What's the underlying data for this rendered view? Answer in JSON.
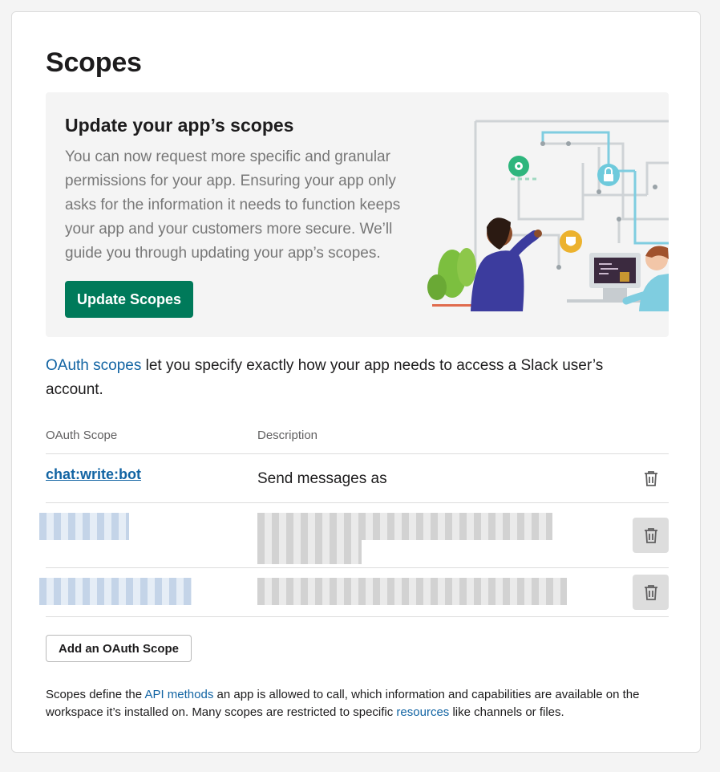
{
  "page": {
    "title": "Scopes"
  },
  "banner": {
    "heading": "Update your app’s scopes",
    "body": "You can now request more specific and granular permissions for your app. Ensuring your app only asks for the information it needs to function keeps your app and your customers more secure. We’ll guide you through updating your app’s scopes.",
    "button_label": "Update Scopes",
    "illustration": "person-drawing-connections-illustration"
  },
  "intro": {
    "link_text": "OAuth scopes",
    "rest": " let you specify exactly how your app needs to access a Slack user’s account."
  },
  "table": {
    "headers": {
      "scope": "OAuth Scope",
      "description": "Description"
    },
    "rows": [
      {
        "scope": "chat:write:bot",
        "description": "Send messages as",
        "delete_icon": "trash-icon"
      },
      {
        "scope": "",
        "description": "",
        "redacted": true,
        "delete_icon": "trash-icon"
      },
      {
        "scope": "",
        "description": "",
        "redacted": true,
        "delete_icon": "trash-icon"
      }
    ]
  },
  "add_button_label": "Add an OAuth Scope",
  "footnote": {
    "part1": "Scopes define the ",
    "link1": "API methods",
    "part2": " an app is allowed to call, which information and capabilities are available on the workspace it’s installed on. Many scopes are restricted to specific ",
    "link2": "resources",
    "part3": " like channels or files."
  },
  "colors": {
    "primary_button": "#007a5a",
    "link": "#1264a3",
    "banner_bg": "#f4f4f4"
  }
}
